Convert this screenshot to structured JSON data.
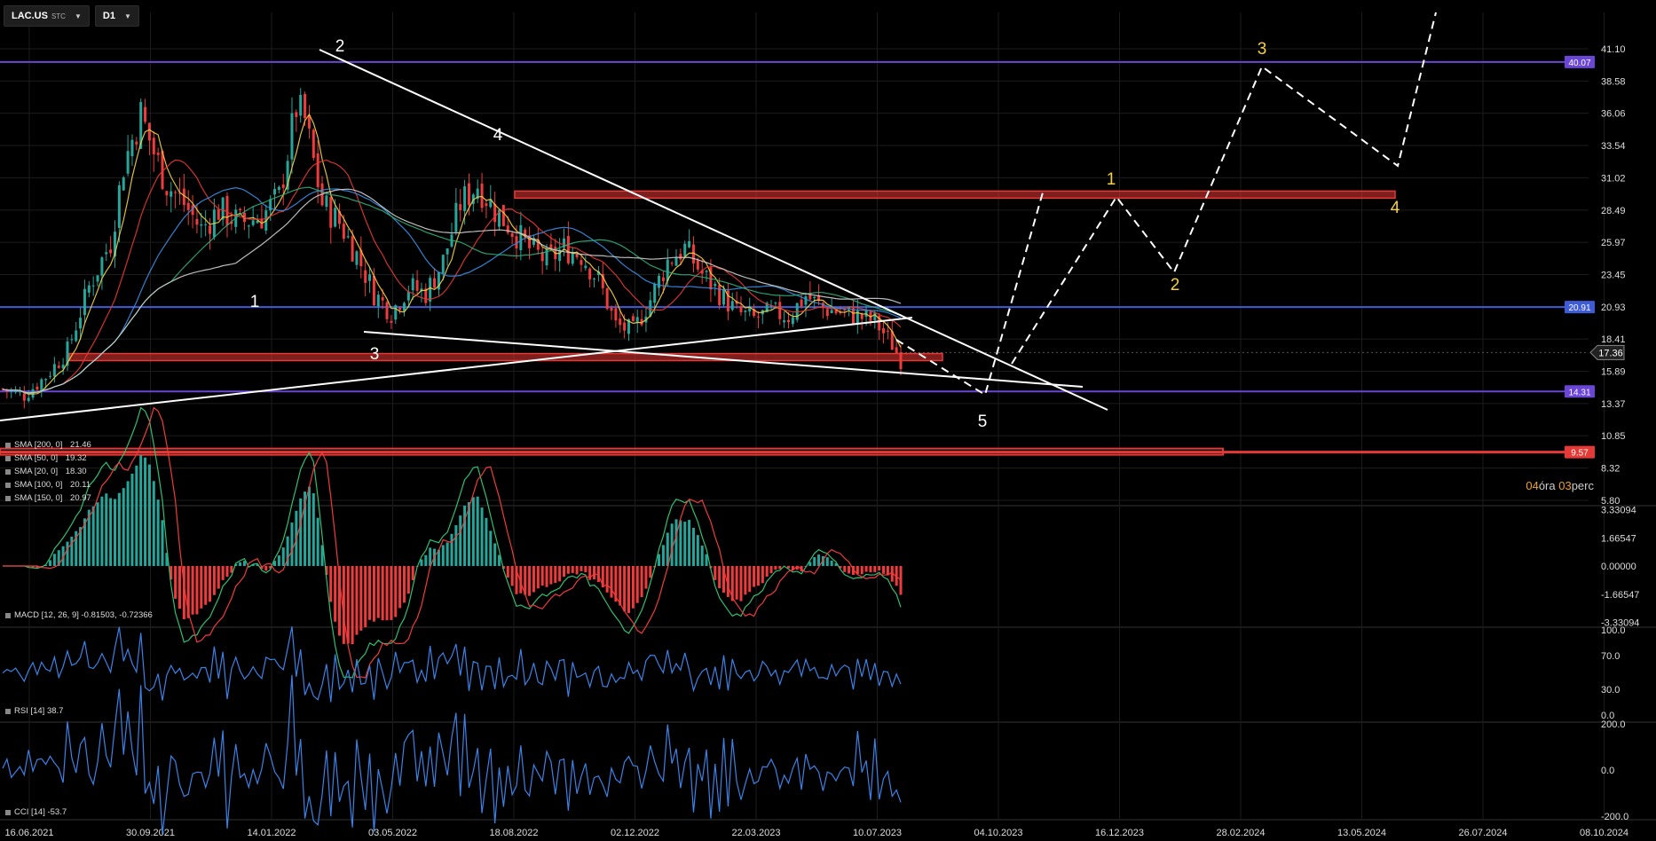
{
  "toolbar": {
    "symbol": "LAC.US",
    "symbol_tag": "STC",
    "timeframe": "D1"
  },
  "countdown": {
    "hours": "04",
    "hours_label": "óra",
    "minutes": "03",
    "minutes_label": "perc"
  },
  "colors": {
    "background": "#000000",
    "bull": "#26a69a",
    "bear": "#ef3b3b",
    "horizontal_purple": "#6b45d6",
    "horizontal_blue": "#3e5bd8",
    "zone_red": "#e53935",
    "wave_white": "#ffffff",
    "wave_yellow": "#f5d142"
  },
  "chart_data": [
    {
      "type": "candlestick",
      "panel": "price",
      "title": "LAC.US D1",
      "y_ticks": [
        "41.10",
        "38.58",
        "36.06",
        "33.54",
        "31.02",
        "28.49",
        "25.97",
        "23.45",
        "20.93",
        "18.41",
        "15.89",
        "13.37",
        "10.85",
        "8.32",
        "5.80"
      ],
      "ylim": [
        5.8,
        41.1
      ],
      "x_ticks": [
        "16.06.2021",
        "30.09.2021",
        "14.01.2022",
        "03.05.2022",
        "18.08.2022",
        "02.12.2022",
        "22.03.2023",
        "10.07.2023",
        "04.10.2023",
        "16.12.2023",
        "28.02.2024",
        "13.05.2024",
        "26.07.2024",
        "08.10.2024"
      ],
      "current_price": "17.36",
      "approx_close_path": [
        [
          0,
          14.5
        ],
        [
          5,
          14.0
        ],
        [
          10,
          15.5
        ],
        [
          15,
          17.5
        ],
        [
          20,
          22.5
        ],
        [
          25,
          26.0
        ],
        [
          28,
          32.0
        ],
        [
          32,
          36.0
        ],
        [
          35,
          33.0
        ],
        [
          38,
          30.5
        ],
        [
          42,
          29.0
        ],
        [
          46,
          27.0
        ],
        [
          50,
          28.5
        ],
        [
          55,
          27.5
        ],
        [
          60,
          28.0
        ],
        [
          64,
          29.5
        ],
        [
          68,
          36.5
        ],
        [
          70,
          35.5
        ],
        [
          74,
          29.0
        ],
        [
          78,
          27.5
        ],
        [
          82,
          25.0
        ],
        [
          86,
          22.0
        ],
        [
          90,
          20.5
        ],
        [
          94,
          22.5
        ],
        [
          98,
          22.0
        ],
        [
          102,
          24.5
        ],
        [
          106,
          29.0
        ],
        [
          110,
          30.5
        ],
        [
          114,
          28.5
        ],
        [
          118,
          27.0
        ],
        [
          122,
          25.5
        ],
        [
          126,
          24.5
        ],
        [
          130,
          25.5
        ],
        [
          134,
          25.0
        ],
        [
          138,
          23.0
        ],
        [
          142,
          19.5
        ],
        [
          146,
          19.0
        ],
        [
          150,
          21.5
        ],
        [
          154,
          24.5
        ],
        [
          158,
          25.5
        ],
        [
          162,
          23.5
        ],
        [
          166,
          22.0
        ],
        [
          170,
          20.5
        ],
        [
          174,
          20.0
        ],
        [
          178,
          20.5
        ],
        [
          182,
          20.2
        ],
        [
          186,
          21.8
        ],
        [
          190,
          20.8
        ],
        [
          194,
          20.5
        ],
        [
          198,
          20.2
        ],
        [
          202,
          19.8
        ],
        [
          206,
          18.0
        ],
        [
          208,
          16.8
        ]
      ],
      "horizontal_levels": [
        {
          "label": "40.07",
          "value": 40.07,
          "color": "#6b45d6"
        },
        {
          "label": "20.91",
          "value": 20.91,
          "color": "#3e5bd8"
        },
        {
          "label": "14.31",
          "value": 14.31,
          "color": "#6b45d6"
        },
        {
          "label": "9.57",
          "value": 9.57,
          "color": "#e53935"
        }
      ],
      "zones": [
        {
          "name": "resistance-zone",
          "value": 29.7
        },
        {
          "name": "support-zone",
          "value": 17.0
        }
      ],
      "moving_averages": [
        {
          "name": "SMA [200, 0]",
          "value": "21.46",
          "color": "#cfcfcf"
        },
        {
          "name": "SMA [50, 0]",
          "value": "19.32",
          "color": "#e53935"
        },
        {
          "name": "SMA [20, 0]",
          "value": "18.30",
          "color": "#f5d142"
        },
        {
          "name": "SMA [100, 0]",
          "value": "20.11",
          "color": "#3a8ee6"
        },
        {
          "name": "SMA [150, 0]",
          "value": "20.97",
          "color": "#2fae7c"
        }
      ],
      "wave_labels_white": [
        "1",
        "2",
        "3",
        "4",
        "5"
      ],
      "wave_labels_yellow": [
        "1",
        "2",
        "3",
        "4"
      ]
    },
    {
      "type": "histogram",
      "panel": "macd",
      "label": "MACD [12, 26, 9] -0.81503, -0.72366",
      "y_ticks": [
        "3.33094",
        "1.66547",
        "0.00000",
        "-1.66547",
        "-3.33094"
      ],
      "ylim": [
        -3.33094,
        3.33094
      ]
    },
    {
      "type": "line",
      "panel": "rsi",
      "label": "RSI [14] 38.7",
      "y_ticks": [
        "100.0",
        "70.0",
        "30.0",
        "0.0"
      ],
      "ylim": [
        0,
        100
      ]
    },
    {
      "type": "line",
      "panel": "cci",
      "label": "CCI [14] -53.7",
      "y_ticks": [
        "200.0",
        "0.0",
        "-200.0"
      ],
      "ylim": [
        -300,
        300
      ]
    }
  ]
}
